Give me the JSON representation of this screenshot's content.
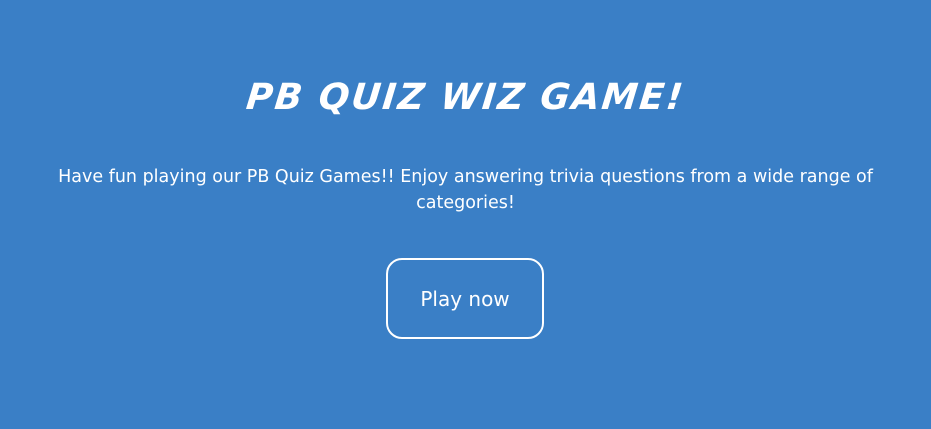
{
  "hero": {
    "title": "PB QUIZ WIZ GAME!",
    "description": "Have fun playing our PB Quiz Games!! Enjoy answering trivia questions from a wide range of categories!",
    "play_label": "Play now"
  },
  "colors": {
    "background": "#3a7fc6",
    "text": "#ffffff",
    "button_border": "#ffffff"
  }
}
